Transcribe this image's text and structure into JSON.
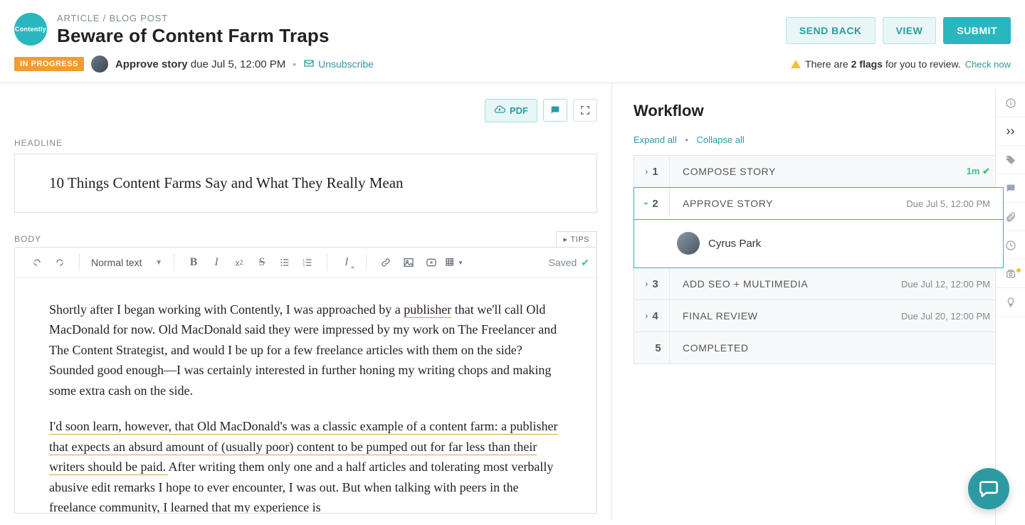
{
  "logo_text": "Contently",
  "breadcrumb": "ARTICLE / BLOG POST",
  "page_title": "Beware of Content Farm Traps",
  "buttons": {
    "send_back": "SEND BACK",
    "view": "VIEW",
    "submit": "SUBMIT"
  },
  "status": {
    "badge": "IN PROGRESS",
    "action": "Approve story",
    "due": "due Jul 5, 12:00 PM",
    "unsubscribe": "Unsubscribe"
  },
  "flags": {
    "prefix": "There are ",
    "count": "2 flags",
    "suffix": " for you to review.",
    "link": "Check now"
  },
  "editor_actions": {
    "pdf": "PDF"
  },
  "headline": {
    "label": "HEADLINE",
    "value": "10 Things Content Farms Say and What They Really Mean"
  },
  "body": {
    "label": "BODY",
    "tips": "TIPS",
    "format": "Normal text",
    "saved": "Saved",
    "p1_a": "Shortly after I began working with Contently, I was approached by a ",
    "p1_link": "publisher",
    "p1_b": " that we'll call Old MacDonald for now. Old MacDonald said they were impressed by my work on The Freelancer and The Content Strategist, and would I be up for a few freelance articles with them on the side? Sounded good enough—I was certainly interested in further honing my writing chops and making some extra cash on the side.",
    "p2_hl": "I'd soon learn, however, that Old MacDonald's was a classic example of a content farm: a publisher that expects an absurd amount of (usually poor) content to be pumped out for far less than their writers should be paid. ",
    "p2_rest": "After writing them only one and a half articles and tolerating most verbally abusive edit remarks I hope to ever encounter, I was out. But when talking with peers in the freelance community, I learned that my experience is"
  },
  "workflow": {
    "title": "Workflow",
    "expand": "Expand all",
    "collapse": "Collapse all",
    "steps": [
      {
        "n": "1",
        "title": "COMPOSE STORY",
        "meta": "1m",
        "done": true,
        "open": false
      },
      {
        "n": "2",
        "title": "APPROVE STORY",
        "meta": "Due Jul 5, 12:00 PM",
        "open": true,
        "assignee": "Cyrus Park"
      },
      {
        "n": "3",
        "title": "ADD SEO + MULTIMEDIA",
        "meta": "Due Jul 12, 12:00 PM",
        "open": false
      },
      {
        "n": "4",
        "title": "FINAL REVIEW",
        "meta": "Due Jul 20, 12:00 PM",
        "open": false
      },
      {
        "n": "5",
        "title": "COMPLETED",
        "meta": "",
        "open": false
      }
    ]
  }
}
